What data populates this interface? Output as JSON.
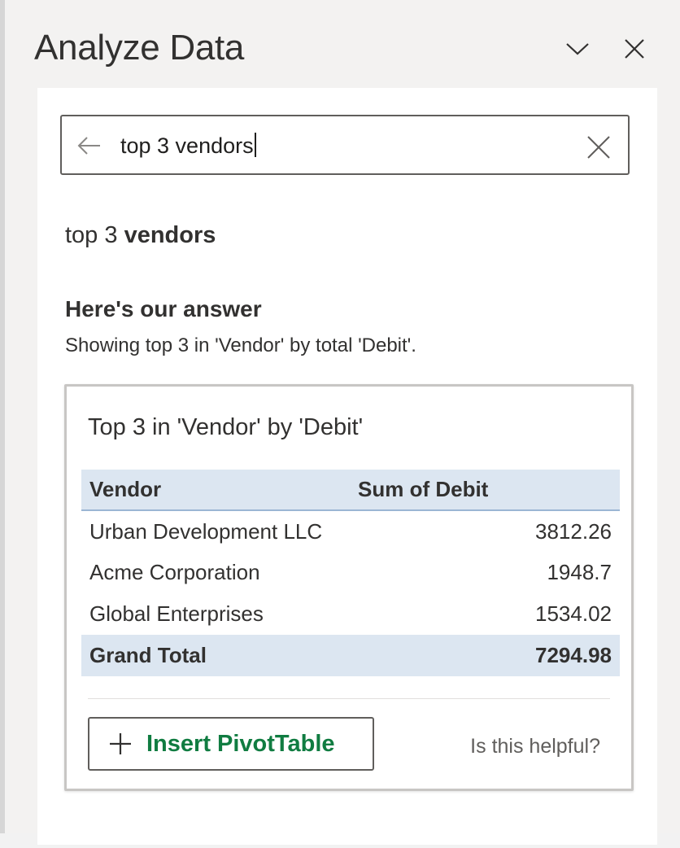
{
  "pane": {
    "title": "Analyze Data"
  },
  "search": {
    "value": "top 3 vendors"
  },
  "query_echo": {
    "plain": "top 3 ",
    "bold": "vendors"
  },
  "answer": {
    "title": "Here's our answer",
    "subtitle": "Showing top 3 in 'Vendor' by total 'Debit'."
  },
  "result": {
    "title": "Top 3 in 'Vendor' by 'Debit'",
    "columns": [
      "Vendor",
      "Sum of Debit"
    ],
    "rows": [
      {
        "vendor": "Urban Development LLC",
        "debit": "3812.26"
      },
      {
        "vendor": "Acme Corporation",
        "debit": "1948.7"
      },
      {
        "vendor": "Global Enterprises",
        "debit": "1534.02"
      }
    ],
    "total": {
      "label": "Grand Total",
      "debit": "7294.98"
    },
    "insert_label": "Insert PivotTable",
    "helpful_label": "Is this helpful?"
  },
  "icons": {
    "collapse": "chevron-down-icon",
    "close": "close-icon",
    "back": "arrow-left-icon",
    "clear": "clear-icon",
    "insert": "plus-icon"
  },
  "colors": {
    "accent_green": "#107c41",
    "header_fill": "#dce6f1"
  }
}
